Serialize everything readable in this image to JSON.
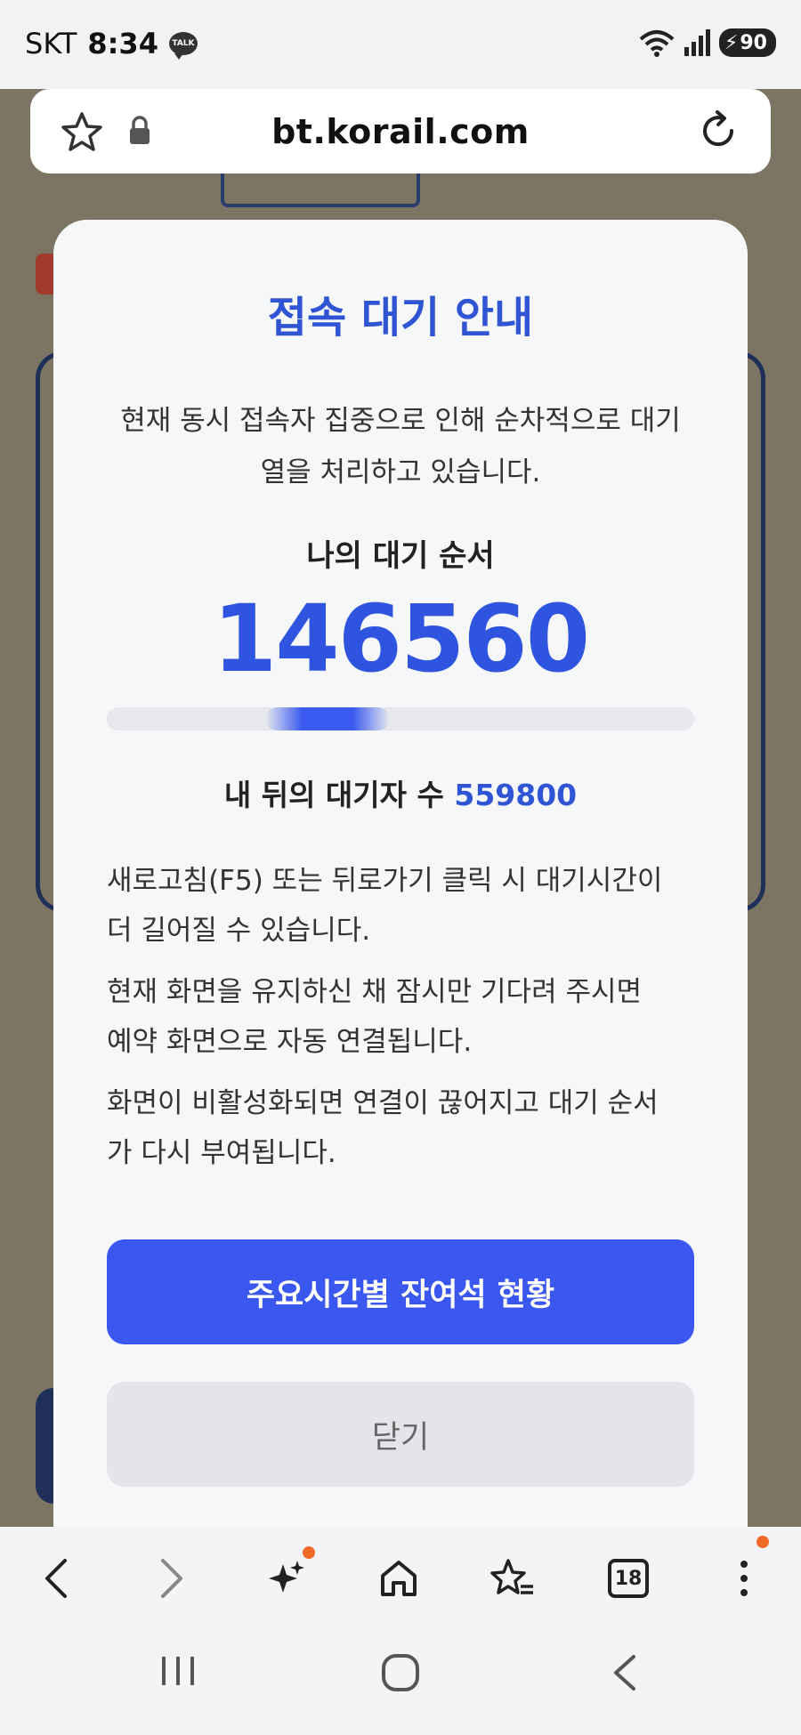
{
  "status_bar": {
    "carrier": "SKT",
    "time": "8:34",
    "talk_badge": "TALK",
    "battery": "90",
    "icons": [
      "talk-icon",
      "wifi-icon",
      "signal-icon",
      "battery-icon"
    ]
  },
  "browser": {
    "url": "bt.korail.com",
    "toolbar_icons": [
      "back-icon",
      "forward-icon",
      "ai-sparkle-icon",
      "home-icon",
      "bookmarks-icon",
      "tabs-icon",
      "more-icon"
    ],
    "tab_count": "18"
  },
  "modal": {
    "title": "접속 대기 안내",
    "description_line1": "현재 동시 접속자 집중으로 인해 순차적으로 대기",
    "description_line2": "열을 처리하고 있습니다.",
    "queue_label": "나의 대기 순서",
    "queue_number": "146560",
    "behind_label": "내 뒤의 대기자 수",
    "behind_count": "559800",
    "notices": [
      {
        "line1": "새로고침(F5) 또는 뒤로가기 클릭 시 대기시간이",
        "line2": "더 길어질 수 있습니다."
      },
      {
        "line1": "현재 화면을 유지하신 채 잠시만 기다려 주시면",
        "line2": "예약 화면으로 자동 연결됩니다."
      },
      {
        "line1": "화면이 비활성화되면 연결이 끊어지고 대기 순서",
        "line2": "가 다시 부여됩니다."
      }
    ],
    "primary_button": "주요시간별 잔여석 현황",
    "close_button": "닫기"
  },
  "colors": {
    "accent": "#3a57f0",
    "title": "#2f55d4",
    "backdrop": "#7d7564",
    "notification_dot": "#f06b2a"
  },
  "navbar": {
    "icons": [
      "recent-apps-icon",
      "home-nav-icon",
      "back-nav-icon"
    ]
  }
}
